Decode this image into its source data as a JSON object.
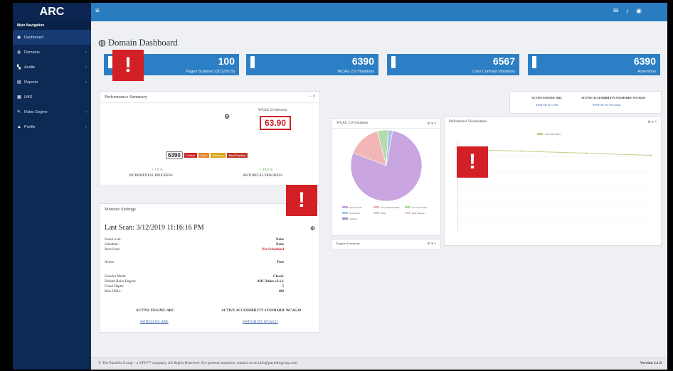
{
  "app": {
    "brand": "ARC"
  },
  "sidebar": {
    "heading": "Main Navigation",
    "items": [
      {
        "label": "Dashboard",
        "icon": "dashboard-icon",
        "glyph": "◉"
      },
      {
        "label": "Domains",
        "icon": "globe-icon",
        "glyph": "◍"
      },
      {
        "label": "Audits",
        "icon": "chart-icon",
        "glyph": "▚"
      },
      {
        "label": "Reports",
        "icon": "document-icon",
        "glyph": "▤"
      },
      {
        "label": "LMS",
        "icon": "grid-icon",
        "glyph": "▦"
      },
      {
        "label": "Rules Engine",
        "icon": "wrench-icon",
        "glyph": "✎"
      },
      {
        "label": "Profile",
        "icon": "user-icon",
        "glyph": "▲"
      }
    ]
  },
  "page": {
    "title": "Domain Dashboard"
  },
  "stats": [
    {
      "value": "100",
      "label": "Pages Scanned (3/12/2019)"
    },
    {
      "value": "6390",
      "label": "WCAG 2.0 Violations"
    },
    {
      "value": "6567",
      "label": "Color Contrast Violations"
    },
    {
      "value": "6390",
      "label": "Assertions"
    }
  ],
  "alert_glyph": "!",
  "perf_summary": {
    "title": "Performance Summary",
    "severity_label": "WCAG 2.0 Severity",
    "severity_value": "63.90",
    "bar_value": "6390",
    "bar_chips": [
      "Critical",
      "Error",
      "Warning",
      "Best Practice"
    ],
    "incremental_value": "+ 7.6 %",
    "incremental_label": "INCREMENTAL PROGRESS",
    "historical_value": "+ 10.3 %",
    "historical_label": "HISTORICAL PROGRESS"
  },
  "monitor": {
    "title": "Monitor Settings",
    "last_scan": "Last Scan: 3/12/2019 11:16:16 PM",
    "rows1": [
      {
        "k": "Scan Level:",
        "v": "None"
      },
      {
        "k": "Schedule:",
        "v": "None"
      },
      {
        "k": "Next Scan:",
        "v": "Not Scheduled"
      }
    ],
    "active_k": "Active",
    "active_v": "True",
    "rows2": [
      {
        "k": "Crawler Mode:",
        "v": "Classic"
      },
      {
        "k": "Default Rules Engine:",
        "v": "ARC Rules v3.1.1"
      },
      {
        "k": "Crawl Depth:",
        "v": "5"
      },
      {
        "k": "Max URLs:",
        "v": "100"
      }
    ],
    "active_engine": "ACTIVE ENGINE: ARC",
    "active_standard": "ACTIVE ACCESSIBILITY STANDARD: WCAG20",
    "switch_engine": "SWITCH TO: AXE",
    "switch_standard": "SWITCH TO: WCAG21"
  },
  "engine_panel": {
    "active_engine": "ACTIVE ENGINE: ARC",
    "active_standard": "ACTIVE ACCESSIBILITY STANDARD: WCAG20",
    "switch_engine": "SWITCH TO: AXE",
    "switch_standard": "SWITCH TO: WCAG21"
  },
  "pie_panel": {
    "title": "WCAG 2.0 Violations",
    "engine_title": "Engine Assertions"
  },
  "chart_data": [
    {
      "type": "pie",
      "values": [
        78,
        15,
        5,
        2
      ],
      "colors": [
        "#c9a6e0",
        "#f2b6b6",
        "#b6dcae",
        "#a9c7e8"
      ],
      "legend": [
        "Not Operable",
        "Not Understandable",
        "Not Perceivable",
        "Not Robust",
        "Other",
        "Best Practice",
        "Violation"
      ]
    },
    {
      "type": "line",
      "title": "Performance Visualization",
      "series": [
        {
          "name": "Severity Index",
          "values": [
            63.9,
            62.5,
            61.0,
            59.3
          ],
          "color": "#b8d486"
        }
      ]
    }
  ],
  "footer": {
    "text": "© The Paciello Group – a VFO™ company. All Rights Reserved. For general enquiries, contact us on info@paciellogroup.com",
    "version": "Version 2.1.0"
  }
}
